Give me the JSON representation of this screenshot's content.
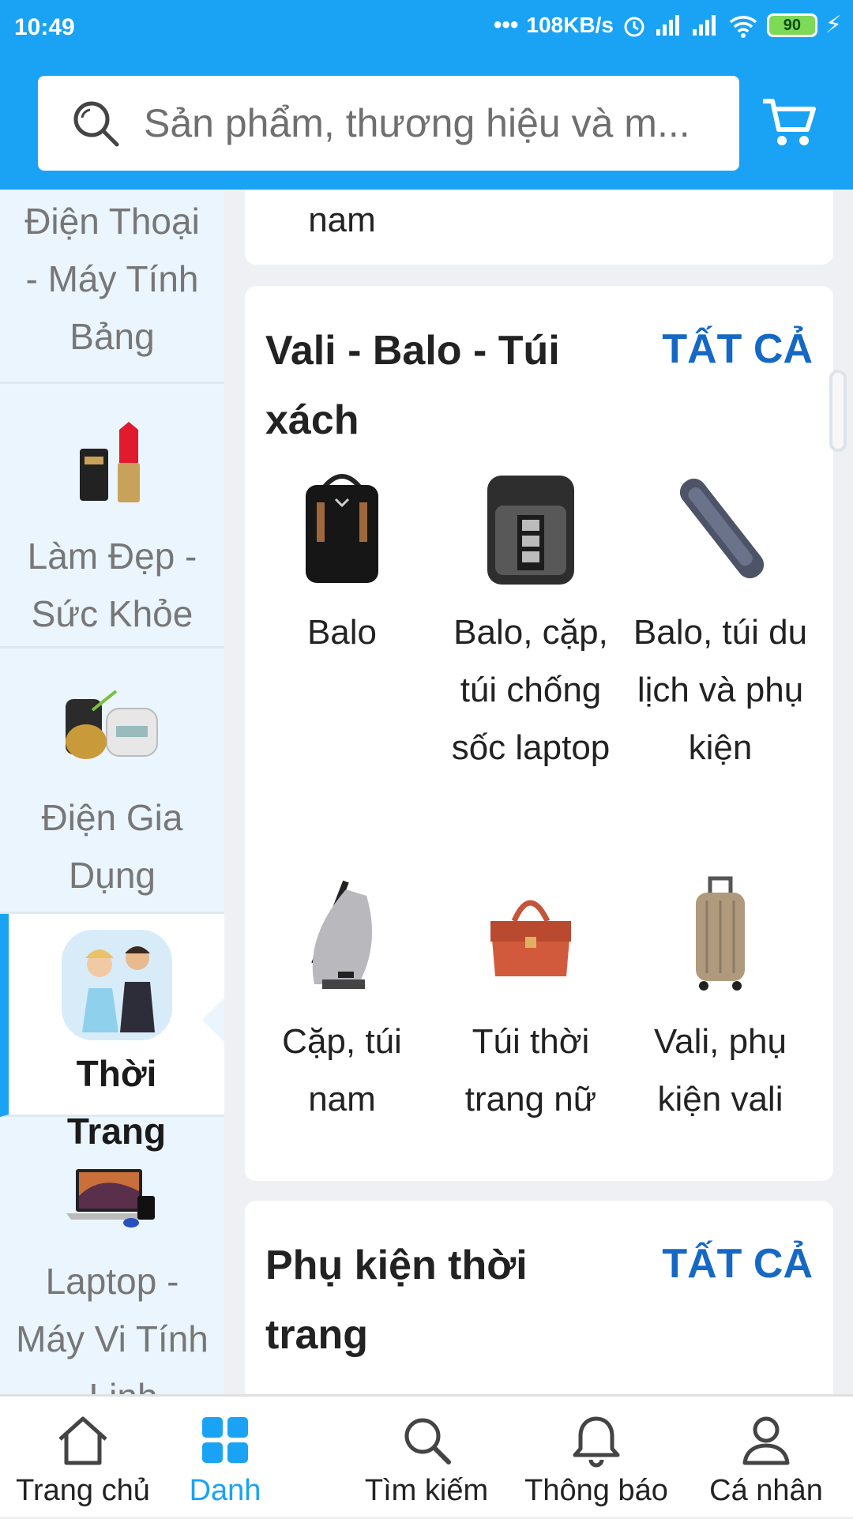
{
  "status_bar": {
    "time": "10:49",
    "network_speed": "108KB/s",
    "battery": "90"
  },
  "search": {
    "placeholder": "Sản phẩm, thương hiệu và m..."
  },
  "sidebar": {
    "items": [
      {
        "label": "Điện Thoại - Máy Tính Bảng"
      },
      {
        "label": "Làm Đẹp - Sức Khỏe"
      },
      {
        "label": "Điện Gia Dụng"
      },
      {
        "label": "Thời Trang"
      },
      {
        "label": "Laptop - Máy Vi Tính - Linh"
      }
    ],
    "active_index": 3
  },
  "main": {
    "previous_card_tail": "nam",
    "sections": [
      {
        "title": "Vali - Balo - Túi xách",
        "see_all": "TẤT CẢ",
        "items": [
          {
            "label": "Balo",
            "icon": "backpack-icon"
          },
          {
            "label": "Balo, cặp, túi chống sốc laptop",
            "icon": "laptop-backpack-icon"
          },
          {
            "label": "Balo, túi du lịch và phụ kiện",
            "icon": "travel-pouch-icon"
          },
          {
            "label": "Cặp, túi nam",
            "icon": "sling-bag-icon"
          },
          {
            "label": "Túi thời trang nữ",
            "icon": "handbag-icon"
          },
          {
            "label": "Vali, phụ kiện vali",
            "icon": "suitcase-icon"
          }
        ]
      },
      {
        "title": "Phụ kiện thời trang",
        "see_all": "TẤT CẢ"
      }
    ]
  },
  "bottom_nav": {
    "items": [
      {
        "label": "Trang chủ",
        "icon": "home-icon"
      },
      {
        "label": "Danh",
        "icon": "grid-icon"
      },
      {
        "label": "Tìm kiếm",
        "icon": "search-icon"
      },
      {
        "label": "Thông báo",
        "icon": "bell-icon"
      },
      {
        "label": "Cá nhân",
        "icon": "user-icon"
      }
    ],
    "active_index": 1
  },
  "colors": {
    "brand": "#1aa3f5",
    "link": "#1568c4",
    "sidebar_bg": "#eaf5fd"
  }
}
